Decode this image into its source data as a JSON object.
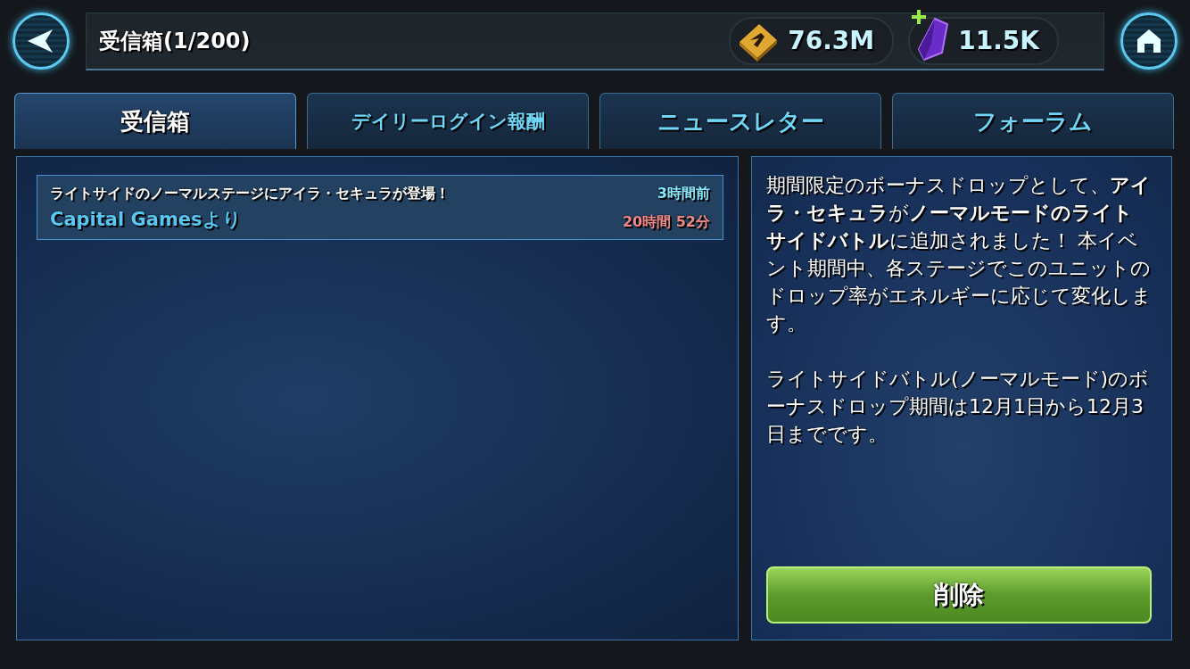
{
  "header": {
    "title": "受信箱(1/200)",
    "currencies": [
      {
        "kind": "credits",
        "amount": "76.3M"
      },
      {
        "kind": "crystals",
        "amount": "11.5K"
      }
    ]
  },
  "tabs": [
    {
      "label": "受信箱",
      "selected": true
    },
    {
      "label": "デイリーログイン報酬",
      "selected": false
    },
    {
      "label": "ニュースレター",
      "selected": false
    },
    {
      "label": "フォーラム",
      "selected": false
    }
  ],
  "messages": [
    {
      "subject": "ライトサイドのノーマルステージにアイラ・セキュラが登場！",
      "sender": "Capital Gamesより",
      "age": "3時間前",
      "expires": "20時間 52分"
    }
  ],
  "detail": {
    "paragraphs": [
      "期間限定のボーナスドロップとして、**アイラ・セキュラ**が**ノーマルモードのライトサイドバトル**に追加されました！ 本イベント期間中、各ステージでこのユニットのドロップ率がエネルギーに応じて変化します。",
      "ライトサイドバトル(ノーマルモード)のボーナスドロップ期間は12月1日から12月3日までです。"
    ],
    "delete_button": "削除"
  }
}
